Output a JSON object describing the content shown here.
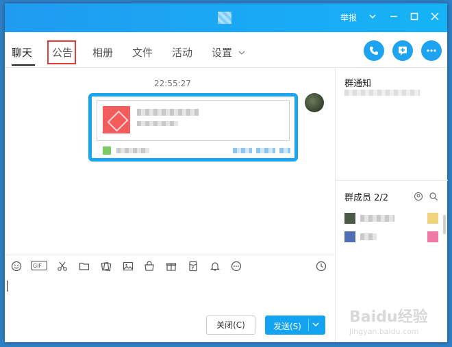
{
  "window": {
    "report_label": "举报"
  },
  "tabs": [
    {
      "label": "聊天"
    },
    {
      "label": "公告"
    },
    {
      "label": "相册"
    },
    {
      "label": "文件"
    },
    {
      "label": "活动"
    },
    {
      "label": "设置"
    }
  ],
  "chat": {
    "timestamp": "22:55:27"
  },
  "toolbar_icons": [
    "emoji-icon",
    "gif-icon",
    "scissors-icon",
    "folder-icon",
    "gallery-icon",
    "image-icon",
    "shop-icon",
    "gift-icon",
    "voice-icon",
    "bell-icon",
    "more-icon",
    "history-icon"
  ],
  "buttons": {
    "close_label": "关闭(C)",
    "send_label": "发送(S)"
  },
  "side": {
    "notice_title": "群通知",
    "members_title": "群成员 2/2",
    "watermark": "Baidu经验",
    "watermark_url": "jingyan.baidu.com"
  },
  "colors": {
    "accent": "#1aa6ee",
    "highlight": "#e03c3c"
  }
}
